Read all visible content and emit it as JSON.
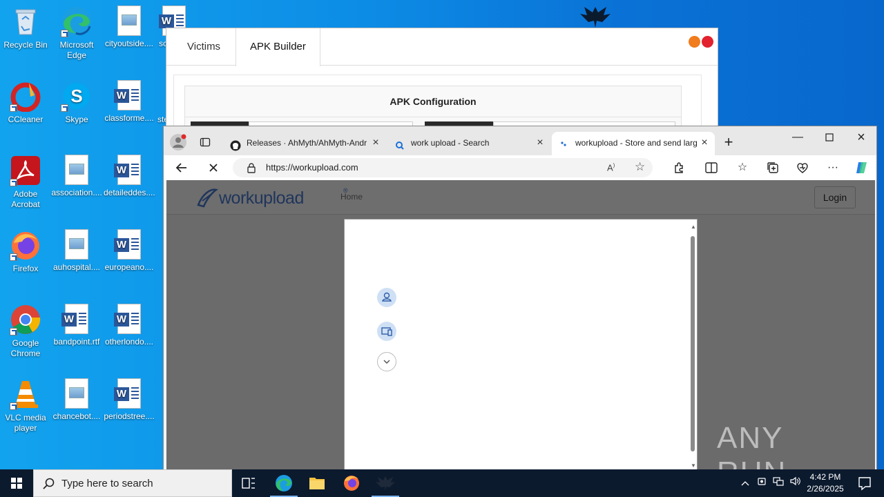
{
  "desktop": {
    "icons": [
      {
        "label": "Recycle Bin"
      },
      {
        "label": "Microsoft Edge"
      },
      {
        "label": "cityoutside...."
      },
      {
        "label": "sc"
      },
      {
        "label": "CCleaner"
      },
      {
        "label": "Skype"
      },
      {
        "label": "classforme...."
      },
      {
        "label": "ste"
      },
      {
        "label": "Adobe Acrobat"
      },
      {
        "label": "association...."
      },
      {
        "label": "detaileddes...."
      },
      {
        "label": "Firefox"
      },
      {
        "label": "auhospital...."
      },
      {
        "label": "europeano...."
      },
      {
        "label": "Google Chrome"
      },
      {
        "label": "bandpoint.rtf"
      },
      {
        "label": "otherlondo...."
      },
      {
        "label": "VLC media player"
      },
      {
        "label": "chancebot...."
      },
      {
        "label": "periodstree...."
      }
    ]
  },
  "ahmyth": {
    "tabs": [
      "Victims",
      "APK Builder"
    ],
    "panel_title": "APK Configuration",
    "colors": {
      "orange": "#f07c1e",
      "red": "#e2222e"
    }
  },
  "browser": {
    "tabs": [
      {
        "title": "Releases · AhMyth/AhMyth-Andr"
      },
      {
        "title": "work upload - Search"
      },
      {
        "title": "workupload - Store and send larg"
      }
    ],
    "url": "https://workupload.com",
    "page": {
      "logo_text": "workupload",
      "logo_mark": "®",
      "nav_home": "Home",
      "login": "Login"
    }
  },
  "watermark": "ANY RUN",
  "taskbar": {
    "search_placeholder": "Type here to search",
    "time": "4:42 PM",
    "date": "2/26/2025"
  }
}
